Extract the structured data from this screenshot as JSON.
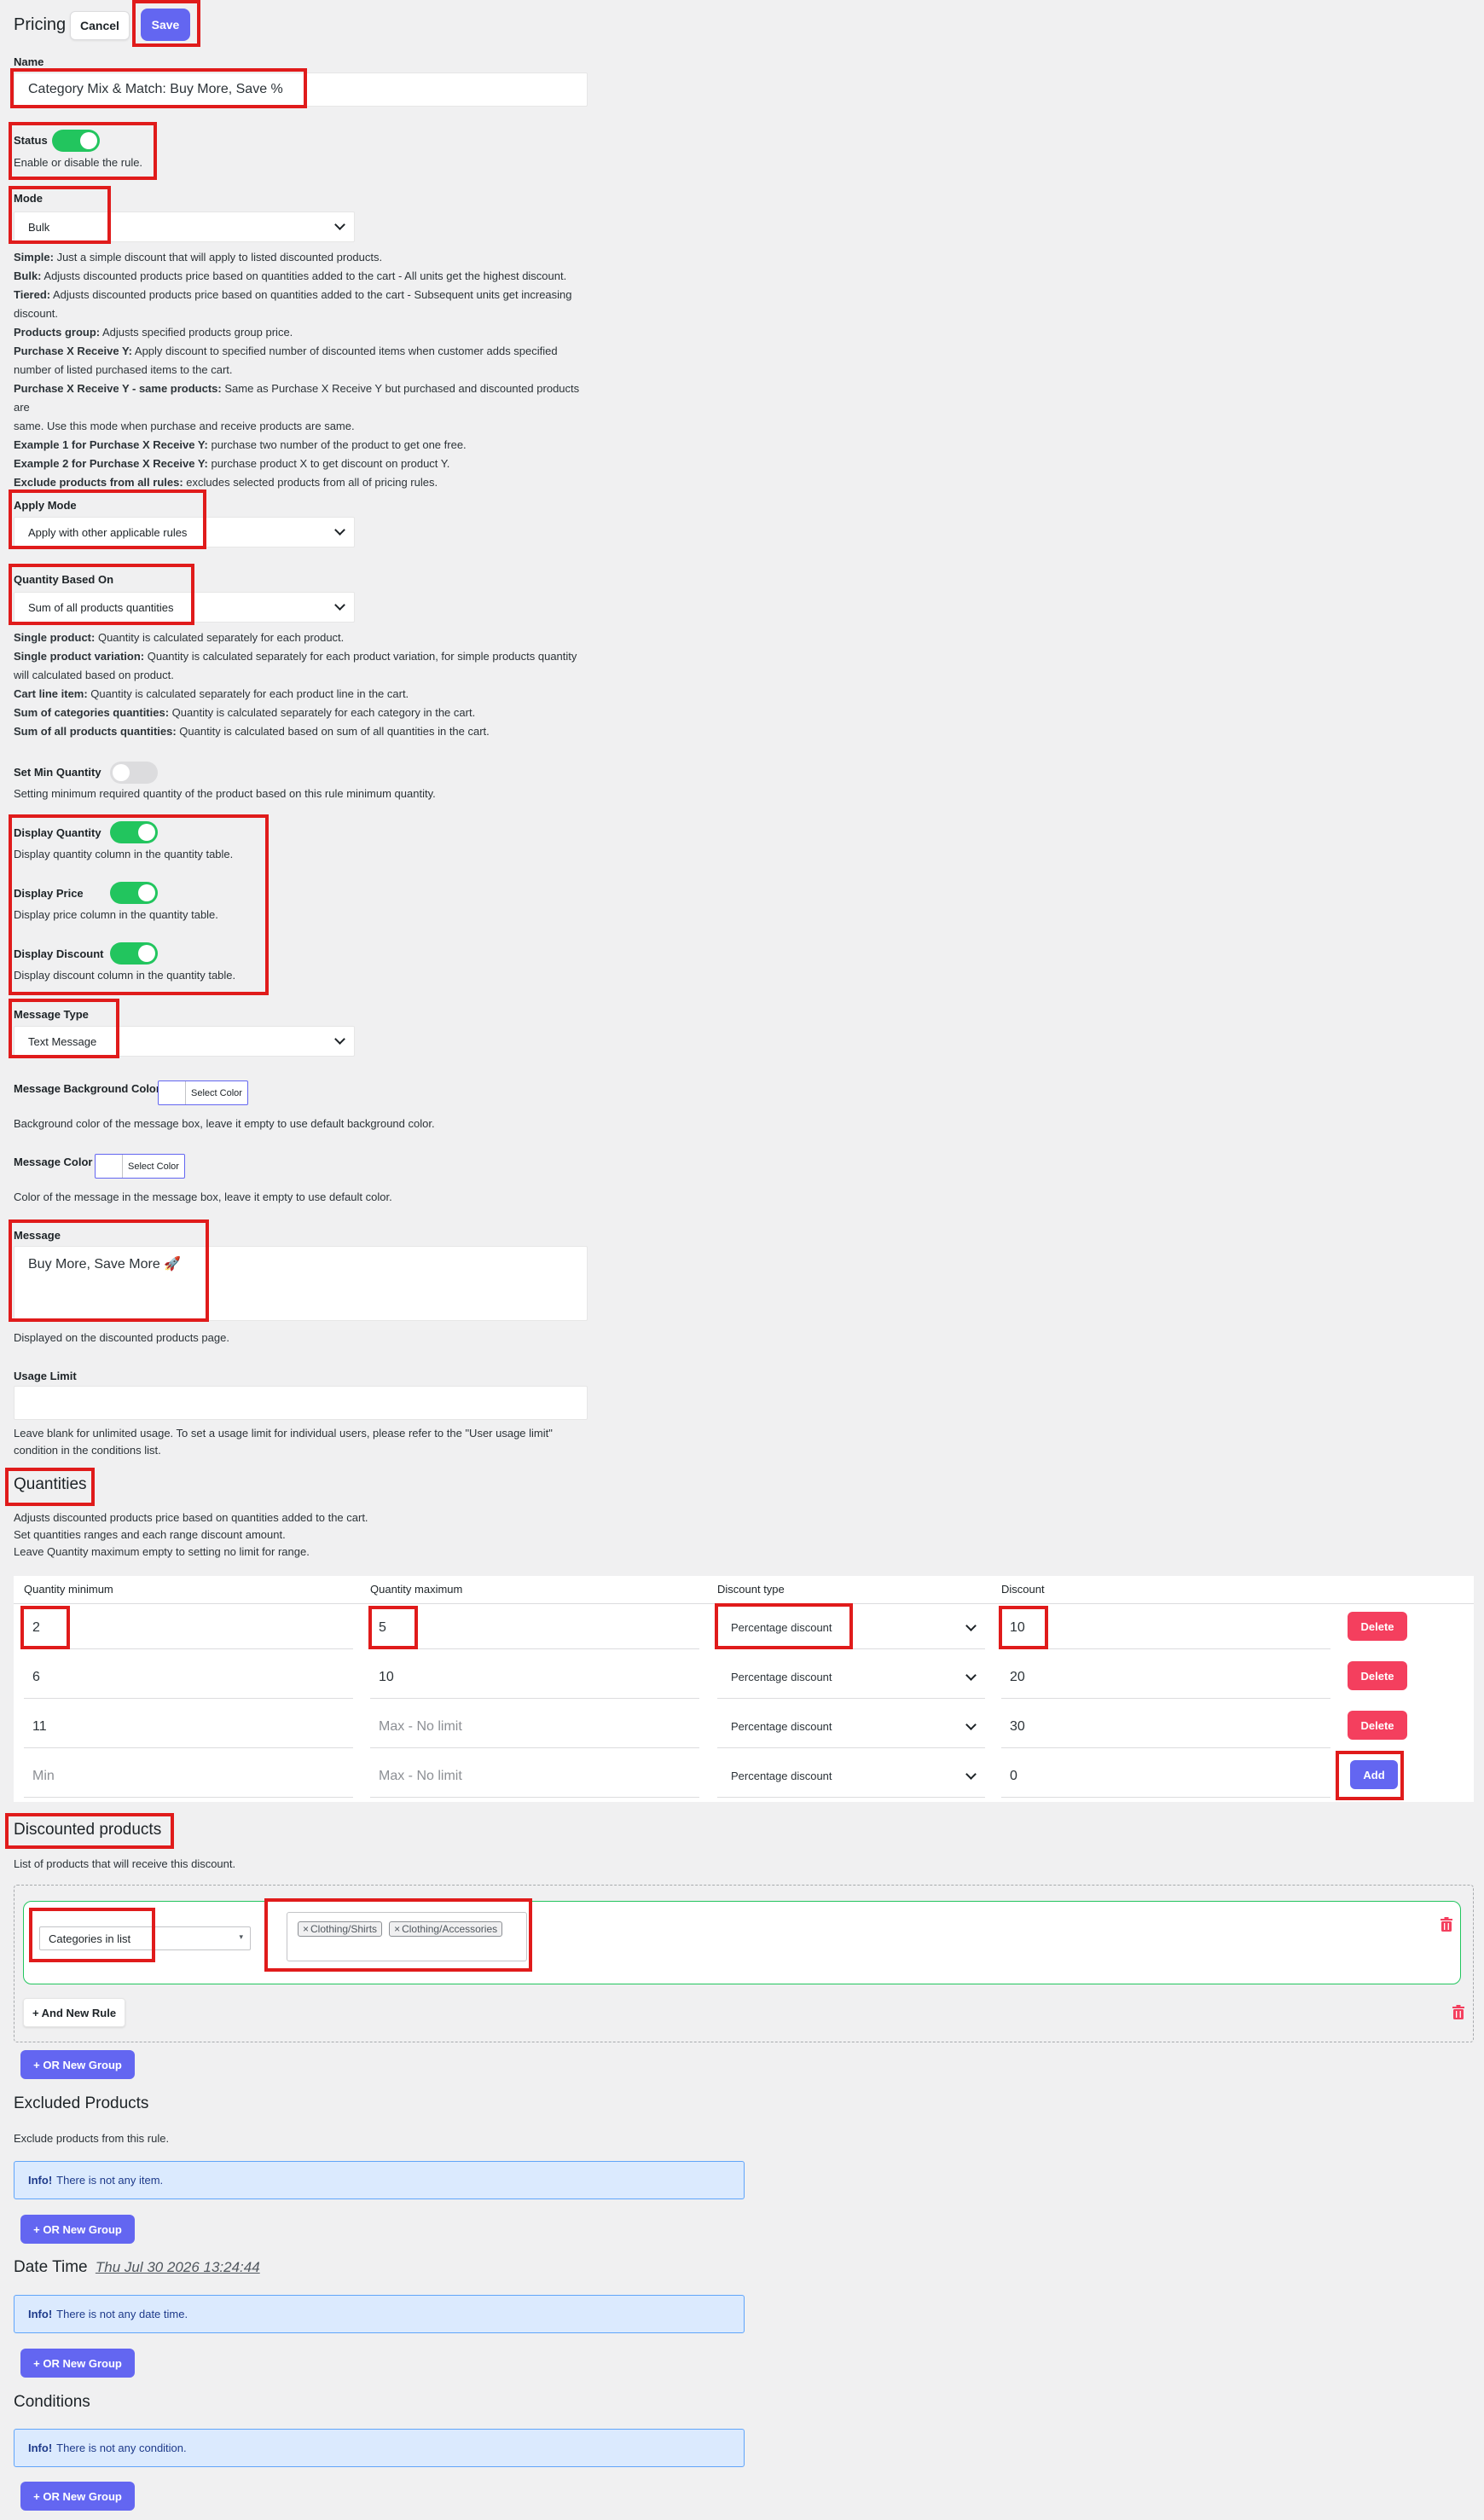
{
  "header": {
    "title": "Pricing",
    "cancel_label": "Cancel",
    "save_label": "Save"
  },
  "name": {
    "label": "Name",
    "value": "Category Mix & Match: Buy More, Save %"
  },
  "status": {
    "label": "Status",
    "enabled": true,
    "help": "Enable or disable the rule."
  },
  "mode": {
    "label": "Mode",
    "selected": "Bulk",
    "help": [
      {
        "term": "Simple:",
        "text": " Just a simple discount that will apply to listed discounted products."
      },
      {
        "term": "Bulk:",
        "text": " Adjusts discounted products price based on quantities added to the cart - All units get the highest discount."
      },
      {
        "term": "Tiered:",
        "text": " Adjusts discounted products price based on quantities added to the cart - Subsequent units get increasing"
      },
      {
        "term": "",
        "text": "discount."
      },
      {
        "term": "Products group:",
        "text": " Adjusts specified products group price."
      },
      {
        "term": "Purchase X Receive Y:",
        "text": " Apply discount to specified number of discounted items when customer adds specified"
      },
      {
        "term": "",
        "text": "number of listed purchased items to the cart."
      },
      {
        "term": "Purchase X Receive Y - same products:",
        "text": " Same as Purchase X Receive Y but purchased and discounted products are"
      },
      {
        "term": "",
        "text": "same. Use this mode when purchase and receive products are same."
      },
      {
        "term": "Example 1 for Purchase X Receive Y:",
        "text": " purchase two number of the product to get one free."
      },
      {
        "term": "Example 2 for Purchase X Receive Y:",
        "text": " purchase product X to get discount on product Y."
      },
      {
        "term": "Exclude products from all rules:",
        "text": " excludes selected products from all of pricing rules."
      }
    ]
  },
  "apply_mode": {
    "label": "Apply Mode",
    "selected": "Apply with other applicable rules"
  },
  "quantity_based_on": {
    "label": "Quantity Based On",
    "selected": "Sum of all products quantities",
    "help": [
      {
        "term": "Single product:",
        "text": " Quantity is calculated separately for each product."
      },
      {
        "term": "Single product variation:",
        "text": " Quantity is calculated separately for each product variation, for simple products quantity"
      },
      {
        "term": "",
        "text": "will calculated based on product."
      },
      {
        "term": "Cart line item:",
        "text": " Quantity is calculated separately for each product line in the cart."
      },
      {
        "term": "Sum of categories quantities:",
        "text": " Quantity is calculated separately for each category in the cart."
      },
      {
        "term": "Sum of all products quantities:",
        "text": " Quantity is calculated based on sum of all quantities in the cart."
      }
    ]
  },
  "min_quantity": {
    "label": "Set Min Quantity",
    "enabled": false,
    "help": "Setting minimum required quantity of the product based on this rule minimum quantity."
  },
  "display_quantity": {
    "label": "Display Quantity",
    "enabled": true,
    "help": "Display quantity column in the quantity table."
  },
  "display_price": {
    "label": "Display Price",
    "enabled": true,
    "help": "Display price column in the quantity table."
  },
  "display_discount": {
    "label": "Display Discount",
    "enabled": true,
    "help": "Display discount column in the quantity table."
  },
  "message_type": {
    "label": "Message Type",
    "selected": "Text Message"
  },
  "message_bg_color": {
    "label": "Message Background Color",
    "button": "Select Color",
    "help": "Background color of the message box, leave it empty to use default background color."
  },
  "message_color": {
    "label": "Message Color",
    "button": "Select Color",
    "help": "Color of the message in the message box, leave it empty to use default color."
  },
  "message": {
    "label": "Message",
    "value": "Buy More, Save More 🚀",
    "help": "Displayed on the discounted products page."
  },
  "usage_limit": {
    "label": "Usage Limit",
    "value": "",
    "help_line1": "Leave blank for unlimited usage. To set a usage limit for individual users, please refer to the \"User usage limit\"",
    "help_line2": "condition in the conditions list."
  },
  "quantities": {
    "title": "Quantities",
    "help": [
      "Adjusts discounted products price based on quantities added to the cart.",
      "Set quantities ranges and each range discount amount.",
      "Leave Quantity maximum empty to setting no limit for range."
    ],
    "columns": [
      "Quantity minimum",
      "Quantity maximum",
      "Discount type",
      "Discount"
    ],
    "rows": [
      {
        "min": "2",
        "max": "5",
        "type": "Percentage discount",
        "discount": "10",
        "action": "Delete"
      },
      {
        "min": "6",
        "max": "10",
        "type": "Percentage discount",
        "discount": "20",
        "action": "Delete"
      },
      {
        "min": "11",
        "max": "",
        "type": "Percentage discount",
        "discount": "30",
        "action": "Delete"
      },
      {
        "min": "",
        "max": "",
        "type": "Percentage discount",
        "discount": "0",
        "action": "Add"
      }
    ],
    "min_placeholder": "Min",
    "max_placeholder": "Max - No limit"
  },
  "discounted_products": {
    "title": "Discounted products",
    "help": "List of products that will receive this discount.",
    "rule_type": "Categories in list",
    "tags": [
      "Clothing/Shirts",
      "Clothing/Accessories"
    ],
    "and_rule_label": "+ And New Rule",
    "or_group_label": "+ OR New Group"
  },
  "excluded_products": {
    "title": "Excluded Products",
    "help": "Exclude products from this rule.",
    "info_strong": "Info!",
    "info_text": "There is not any item.",
    "or_group_label": "+ OR New Group"
  },
  "date_time": {
    "title": "Date Time",
    "value": "Thu Jul 30 2026 13:24:44",
    "info_strong": "Info!",
    "info_text": "There is not any date time.",
    "or_group_label": "+ OR New Group"
  },
  "conditions": {
    "title": "Conditions",
    "info_strong": "Info!",
    "info_text": "There is not any condition.",
    "or_group_label": "+ OR New Group"
  },
  "colors": {
    "accent": "#6366f1",
    "toggle_on": "#22c55e",
    "danger": "#f43f5e",
    "highlight": "#e01b1b"
  }
}
